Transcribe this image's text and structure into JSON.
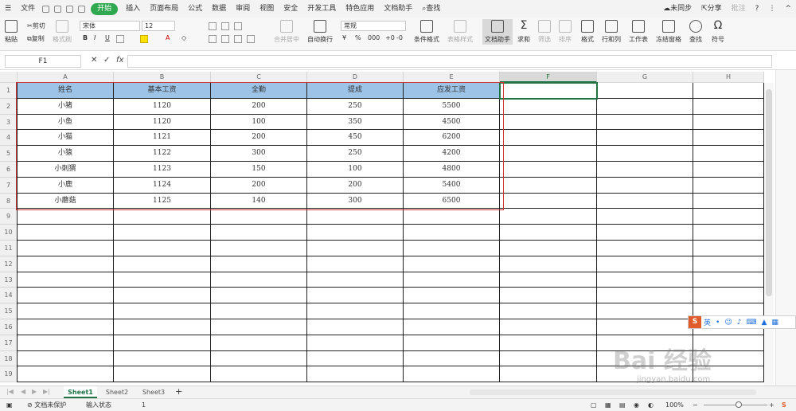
{
  "menubar": {
    "file": "文件",
    "tabs": [
      "开始",
      "插入",
      "页面布局",
      "公式",
      "数据",
      "审阅",
      "视图",
      "安全",
      "开发工具",
      "特色应用",
      "文档助手"
    ],
    "search": "查找",
    "sync": "未同步",
    "share": "分享",
    "comment": "批注"
  },
  "ribbon": {
    "paste": "粘贴",
    "cut": "剪切",
    "copy": "复制",
    "format_painter": "格式刷",
    "font_name": "宋体",
    "font_size": "12",
    "merge_center": "合并居中",
    "wrap_text": "自动换行",
    "number_format": "常规",
    "cond_format": "条件格式",
    "table_style": "表格样式",
    "doc_helper": "文档助手",
    "sum": "求和",
    "filter": "筛选",
    "sort": "排序",
    "format": "格式",
    "row_col": "行和列",
    "worksheet": "工作表",
    "freeze": "冻结窗格",
    "find": "查找",
    "symbol": "符号"
  },
  "formula_bar": {
    "name_box": "F1",
    "fx": "fx",
    "value": ""
  },
  "columns": [
    "A",
    "B",
    "C",
    "D",
    "E",
    "F",
    "G",
    "H"
  ],
  "rows": [
    "1",
    "2",
    "3",
    "4",
    "5",
    "6",
    "7",
    "8",
    "9",
    "10",
    "11",
    "12",
    "13",
    "14",
    "15",
    "16",
    "17",
    "18",
    "19"
  ],
  "table": {
    "headers": [
      "姓名",
      "基本工资",
      "全勤",
      "提成",
      "应发工资"
    ],
    "rows": [
      [
        "小猪",
        "1120",
        "200",
        "250",
        "5500"
      ],
      [
        "小鱼",
        "1120",
        "100",
        "350",
        "4500"
      ],
      [
        "小猫",
        "1121",
        "200",
        "450",
        "6200"
      ],
      [
        "小猿",
        "1122",
        "300",
        "250",
        "4200"
      ],
      [
        "小刺猬",
        "1123",
        "150",
        "100",
        "4800"
      ],
      [
        "小鹿",
        "1124",
        "200",
        "200",
        "5400"
      ],
      [
        "小蘑菇",
        "1125",
        "140",
        "300",
        "6500"
      ]
    ]
  },
  "sheets": [
    "Sheet1",
    "Sheet2",
    "Sheet3"
  ],
  "status": {
    "protect": "文档未保护",
    "input_state": "输入状态",
    "value": "1",
    "zoom": "100%"
  },
  "ime": {
    "lang": "英"
  },
  "watermark": {
    "main": "Bai 经验",
    "url": "jingyan.baidu.com"
  },
  "colors": {
    "accent_green": "#2fa84f",
    "header_fill": "#9dc3e6",
    "selection_red": "#cc3333"
  }
}
